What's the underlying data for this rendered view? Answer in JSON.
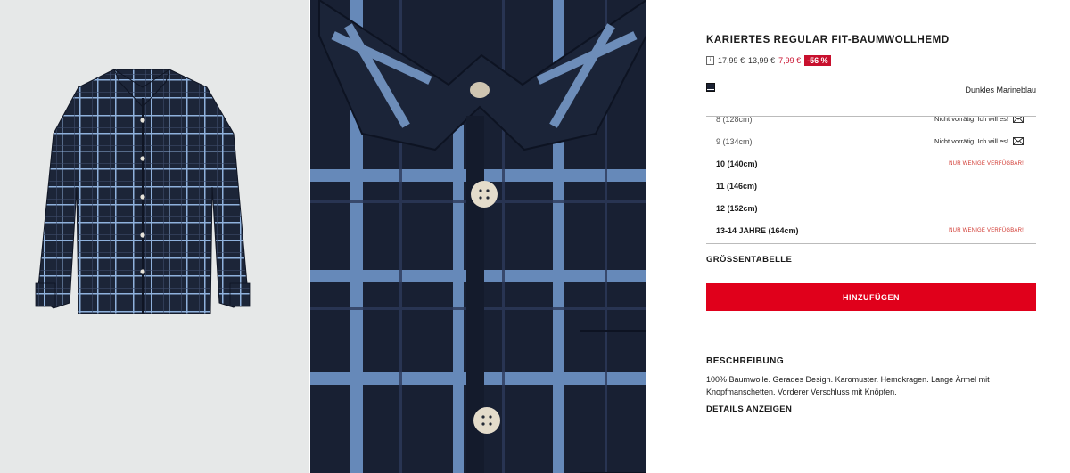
{
  "product": {
    "title": "KARIERTES REGULAR FIT-BAUMWOLLHEMD",
    "info_icon": "i",
    "price_original": "17,99 €",
    "price_previous": "13,99 €",
    "price_current": "7,99 €",
    "discount": "-56 %",
    "color_name": "Dunkles Marineblau",
    "color_swatch": "#1b2233"
  },
  "sizes": [
    {
      "label": "8 (128cm)",
      "status": "Nicht vorrätig. Ich will es!",
      "available": false
    },
    {
      "label": "9 (134cm)",
      "status": "Nicht vorrätig. Ich will es!",
      "available": false
    },
    {
      "label": "10 (140cm)",
      "status": "NUR WENIGE VERFÜGBAR!",
      "available": true
    },
    {
      "label": "11 (146cm)",
      "status": "",
      "available": true
    },
    {
      "label": "12 (152cm)",
      "status": "",
      "available": true
    },
    {
      "label": "13-14 JAHRE (164cm)",
      "status": "NUR WENIGE VERFÜGBAR!",
      "available": true
    }
  ],
  "size_guide_label": "GRÖSSENTABELLE",
  "add_button_label": "HINZUFÜGEN",
  "description": {
    "title": "BESCHREIBUNG",
    "text": "100% Baumwolle. Gerades Design. Karomuster. Hemdkragen. Lange Ärmel mit Knopfmanschetten. Vorderer Verschluss mit Knöpfen.",
    "details_link": "DETAILS ANZEIGEN"
  },
  "colors": {
    "accent_red": "#e0001b",
    "sale_red": "#c8102e",
    "fabric_navy": "#1a2236",
    "check_blue": "#7ea4d4"
  },
  "icons": {
    "notify": "envelope-icon",
    "info": "info-icon"
  }
}
